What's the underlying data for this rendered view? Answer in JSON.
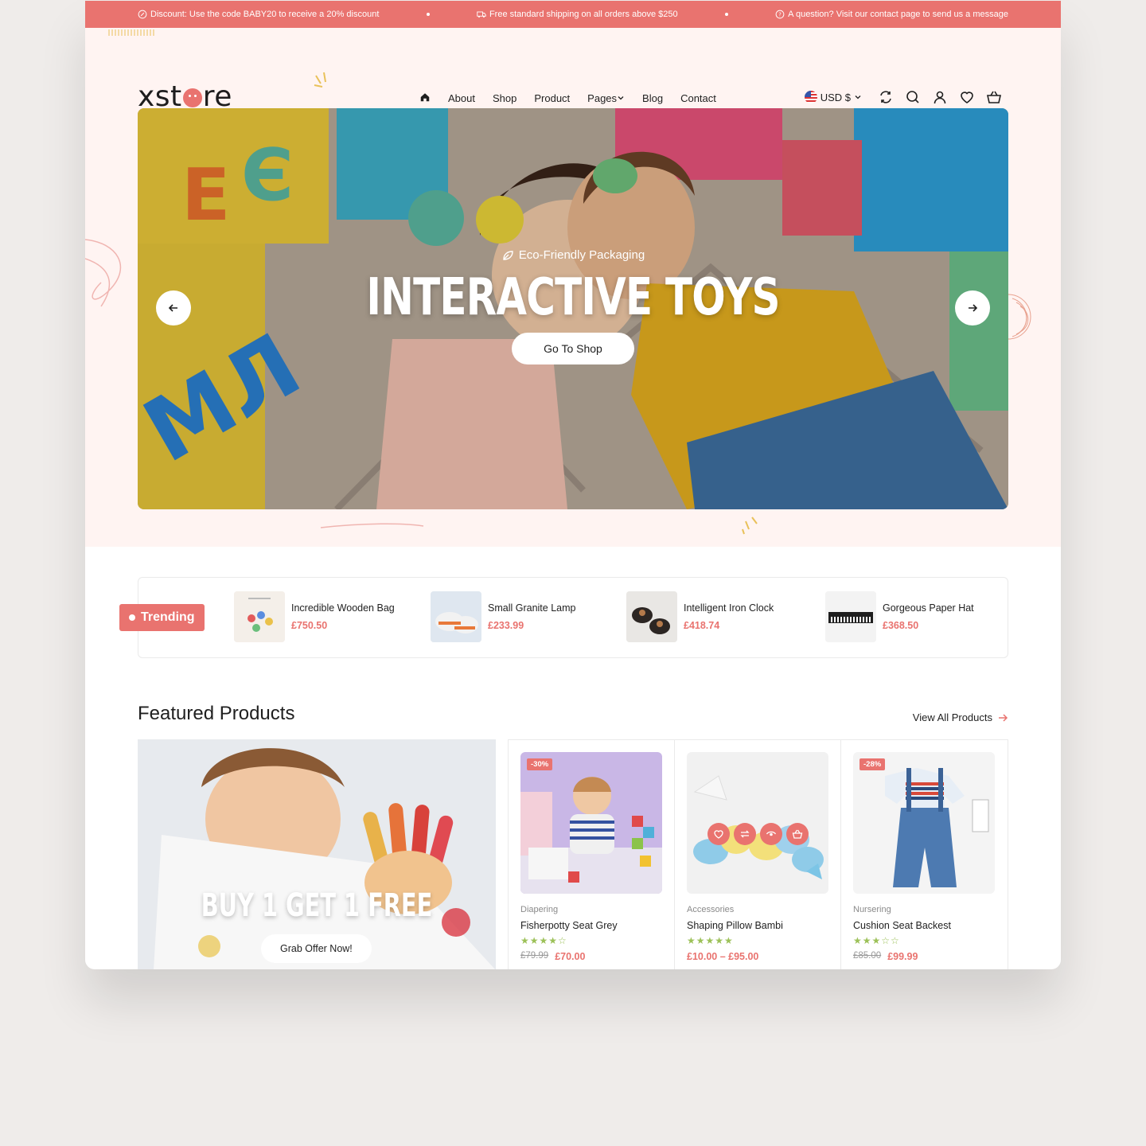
{
  "topbar": {
    "discount": "Discount: Use the code BABY20 to receive a 20% discount",
    "shipping": "Free standard shipping on all orders above $250",
    "question": "A question? Visit our contact page to send us a message"
  },
  "brand": {
    "logo_left": "xst",
    "logo_right": "re",
    "accent": "#e9736f"
  },
  "nav": {
    "about": "About",
    "shop": "Shop",
    "product": "Product",
    "pages": "Pages",
    "blog": "Blog",
    "contact": "Contact"
  },
  "header": {
    "currency": "USD $"
  },
  "hero": {
    "eyebrow": "Eco-Friendly Packaging",
    "title": "INTERACTIVE TOYS",
    "button": "Go To Shop"
  },
  "trending": {
    "label": "Trending",
    "items": [
      {
        "name": "Incredible Wooden Bag",
        "price": "£750.50"
      },
      {
        "name": "Small Granite Lamp",
        "price": "£233.99"
      },
      {
        "name": "Intelligent Iron Clock",
        "price": "£418.74"
      },
      {
        "name": "Gorgeous Paper Hat",
        "price": "£368.50"
      }
    ]
  },
  "featured": {
    "title": "Featured Products",
    "view_all": "View All Products",
    "promo_title": "BUY 1 GET 1 FREE",
    "promo_button": "Grab Offer Now!",
    "products": [
      {
        "badge": "-30%",
        "category": "Diapering",
        "name": "Fisherpotty Seat Grey",
        "stars": "★★★★☆",
        "old_price": "£79.99",
        "price": "£70.00"
      },
      {
        "badge": "",
        "category": "Accessories",
        "name": "Shaping Pillow Bambi",
        "stars": "★★★★★",
        "old_price": "",
        "price": "£10.00 – £95.00"
      },
      {
        "badge": "-28%",
        "category": "Nursering",
        "name": "Cushion Seat Backest",
        "stars": "★★★☆☆",
        "old_price": "£85.00",
        "price": "£99.99"
      }
    ]
  }
}
